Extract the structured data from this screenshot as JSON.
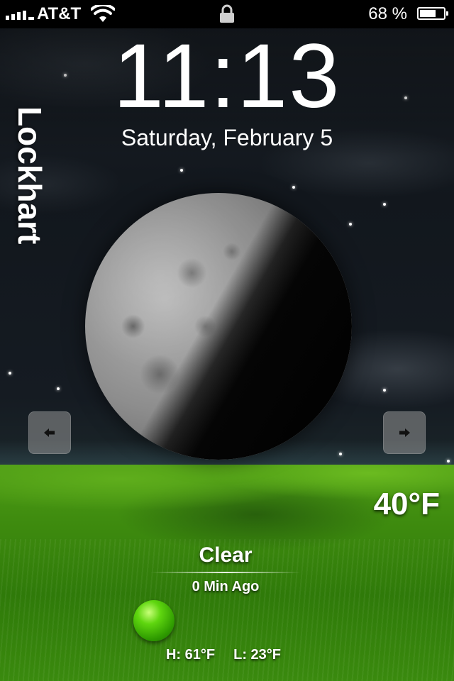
{
  "status_bar": {
    "carrier": "AT&T",
    "signal_bars": 5,
    "battery_percent_label": "68 %",
    "battery_level": 0.68,
    "icons": [
      "signal-icon",
      "wifi-icon",
      "lock-icon",
      "battery-icon"
    ]
  },
  "lock_clock": {
    "time": "11:13",
    "date": "Saturday, February 5"
  },
  "location": {
    "name": "Lockhart"
  },
  "navigation": {
    "prev_icon": "arrow-left-icon",
    "next_icon": "arrow-right-icon"
  },
  "weather": {
    "temperature": "40°F",
    "condition": "Clear",
    "updated": "0 Min Ago",
    "high": "H: 61°F",
    "low": "L: 23°F",
    "status_orb_icon": "status-orb-icon",
    "moon_icon": "moon-phase-icon"
  },
  "colors": {
    "orb_green": "#5fd60f",
    "grass_green": "#3f8c0f",
    "sky_dark": "#12171d"
  }
}
